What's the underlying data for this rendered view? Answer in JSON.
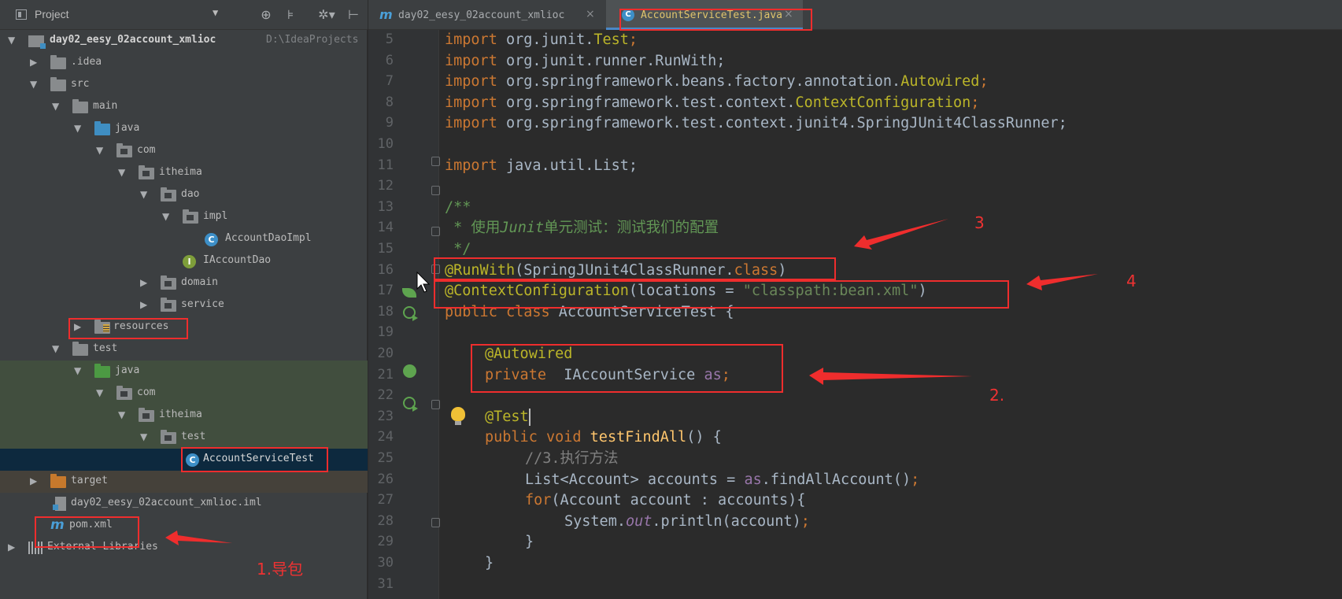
{
  "project_panel": {
    "title": "Project",
    "caret": "▼",
    "toolbar_icons": [
      "target-icon",
      "collapse-icon",
      "settings-icon",
      "hide-icon"
    ],
    "toolbar_glyphs": [
      "⊕",
      "⊧",
      "✲▾",
      "⊢"
    ],
    "tree_arrows": {
      "expanded": "▼",
      "collapsed": "▶"
    },
    "root_name": "day02_eesy_02account_xmlioc",
    "root_path": "D:\\IdeaProjects",
    "items": [
      {
        "label": ".idea"
      },
      {
        "label": "src"
      },
      {
        "label": "main"
      },
      {
        "label": "java"
      },
      {
        "label": "com"
      },
      {
        "label": "itheima"
      },
      {
        "label": "dao"
      },
      {
        "label": "impl"
      },
      {
        "label": "AccountDaoImpl",
        "badge": "C"
      },
      {
        "label": "IAccountDao",
        "badge": "I"
      },
      {
        "label": "domain"
      },
      {
        "label": "service"
      },
      {
        "label": "resources"
      },
      {
        "label": "test"
      },
      {
        "label": "java"
      },
      {
        "label": "com"
      },
      {
        "label": "itheima"
      },
      {
        "label": "test"
      },
      {
        "label": "AccountServiceTest",
        "badge": "C"
      },
      {
        "label": "target"
      },
      {
        "label": "day02_eesy_02account_xmlioc.iml"
      },
      {
        "label": "pom.xml",
        "badge": "m"
      },
      {
        "label": "External Libraries"
      }
    ]
  },
  "tabs": [
    {
      "label": "day02_eesy_02account_xmlioc",
      "icon": "m",
      "close": "×"
    },
    {
      "label": "AccountServiceTest.java",
      "icon": "C",
      "close": "×",
      "active": true
    }
  ],
  "editor": {
    "line_numbers": [
      "5",
      "6",
      "7",
      "8",
      "9",
      "10",
      "11",
      "12",
      "13",
      "14",
      "15",
      "16",
      "17",
      "18",
      "19",
      "20",
      "21",
      "22",
      "23",
      "24",
      "25",
      "26",
      "27",
      "28",
      "29",
      "30",
      "31"
    ],
    "lines": {
      "l5": {
        "kw": "import",
        "pkg": " org.junit.",
        "cls": "Test",
        "end": ";"
      },
      "l6": {
        "kw": "import",
        "rest": " org.junit.runner.RunWith;"
      },
      "l7": {
        "kw": "import",
        "pkg": " org.springframework.beans.factory.annotation.",
        "cls": "Autowired",
        "end": ";"
      },
      "l8": {
        "kw": "import",
        "pkg": " org.springframework.test.context.",
        "cls": "ContextConfiguration",
        "end": ";"
      },
      "l9": {
        "kw": "import",
        "rest": " org.springframework.test.context.junit4.SpringJUnit4ClassRunner;"
      },
      "l11": {
        "kw": "import",
        "rest": " java.util.List;"
      },
      "l13": {
        "text": "/**"
      },
      "l14": {
        "pre": " * 使用",
        "ital": "Junit",
        "post": "单元测试：测试我们的配置"
      },
      "l15": {
        "text": " */"
      },
      "l16": {
        "ann": "@RunWith",
        "a": "(SpringJUnit4ClassRunner.",
        "kw": "class",
        "b": ")"
      },
      "l17": {
        "ann": "@ContextConfiguration",
        "a": "(locations = ",
        "str": "\"classpath:bean.xml\"",
        "b": ")"
      },
      "l18": {
        "kw": "public class",
        "rest": " AccountServiceTest {"
      },
      "l20": {
        "ann": "@Autowired"
      },
      "l21": {
        "kw": "private",
        "type": "  IAccountService ",
        "fld": "as",
        "end": ";"
      },
      "l23": {
        "ann": "@Test"
      },
      "l24": {
        "kw": "public void",
        "fn": " testFindAll",
        "rest": "() {"
      },
      "l25": {
        "text": "//3.执行方法"
      },
      "l26": {
        "a": "List<Account> accounts = ",
        "fld": "as",
        "b": ".findAllAccount()",
        "end": ";"
      },
      "l27": {
        "kw": "for",
        "rest": "(Account account : accounts){"
      },
      "l28": {
        "a": "System.",
        "ital": "out",
        "b": ".println(account)",
        "end": ";"
      },
      "l29": {
        "text": "}"
      },
      "l30": {
        "text": "}"
      }
    }
  },
  "annotations": {
    "n1": "1.导包",
    "n2": "2.",
    "n3": "3",
    "n4": "4"
  },
  "colors": {
    "annotation_red": "#ef2d2d",
    "keyword": "#cc7832",
    "annotation": "#bbb529",
    "string": "#6a8759",
    "comment": "#629755"
  }
}
